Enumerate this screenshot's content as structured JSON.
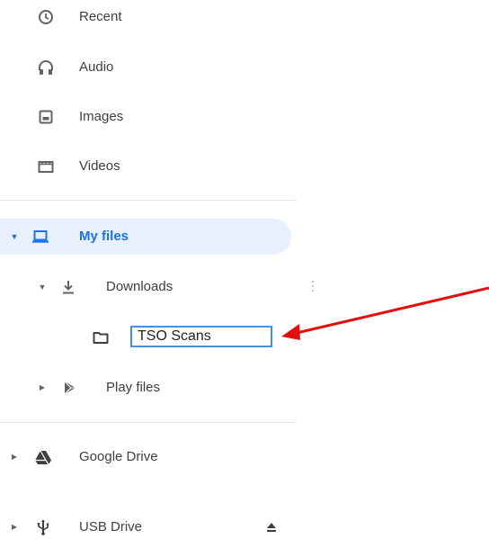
{
  "nav": {
    "recent_label": "Recent",
    "audio_label": "Audio",
    "images_label": "Images",
    "videos_label": "Videos",
    "my_files_label": "My files",
    "downloads_label": "Downloads",
    "rename_value": "TSO Scans",
    "play_files_label": "Play files",
    "google_drive_label": "Google Drive",
    "usb_drive_label": "USB Drive"
  },
  "colors": {
    "selected_bg": "#e8f0fe",
    "accent_blue": "#1a73e8",
    "rename_border": "#4a90e2",
    "annotation_arrow": "#e01010",
    "icon_gray": "#5f6368"
  },
  "icons": {
    "recent": "clock-icon",
    "audio": "headphones-icon",
    "images": "image-icon",
    "videos": "film-icon",
    "my_files": "laptop-icon",
    "downloads": "download-icon",
    "folder": "folder-icon",
    "play_files": "play-store-icon",
    "google_drive": "drive-icon",
    "usb_drive": "usb-icon",
    "eject": "eject-icon"
  }
}
